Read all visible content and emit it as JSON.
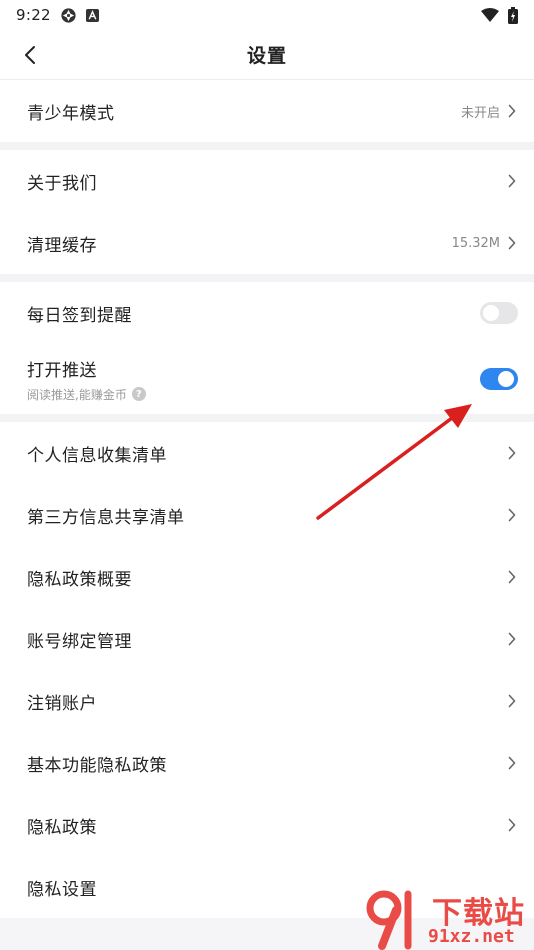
{
  "status_bar": {
    "time": "9:22",
    "icons_left": [
      "sync-icon",
      "app-a-icon"
    ],
    "icons_right": [
      "wifi-icon",
      "battery-charging-icon"
    ]
  },
  "nav": {
    "title": "设置",
    "back_icon": "back-chevron-icon"
  },
  "groups": {
    "youth": {
      "label": "青少年模式",
      "value": "未开启"
    },
    "about": {
      "label": "关于我们"
    },
    "cache": {
      "label": "清理缓存",
      "value": "15.32M"
    },
    "checkin": {
      "label": "每日签到提醒",
      "enabled": false
    },
    "push": {
      "label": "打开推送",
      "sub": "阅读推送,能赚金币",
      "enabled": true
    },
    "list": [
      {
        "label": "个人信息收集清单"
      },
      {
        "label": "第三方信息共享清单"
      },
      {
        "label": "隐私政策概要"
      },
      {
        "label": "账号绑定管理"
      },
      {
        "label": "注销账户"
      },
      {
        "label": "基本功能隐私政策"
      },
      {
        "label": "隐私政策"
      },
      {
        "label": "隐私设置"
      }
    ]
  },
  "colors": {
    "accent": "#2f86ee",
    "annotation_arrow": "#d9201f",
    "watermark": "#e94c47"
  },
  "watermark": {
    "title": "下载站",
    "url": "91xz.net"
  }
}
